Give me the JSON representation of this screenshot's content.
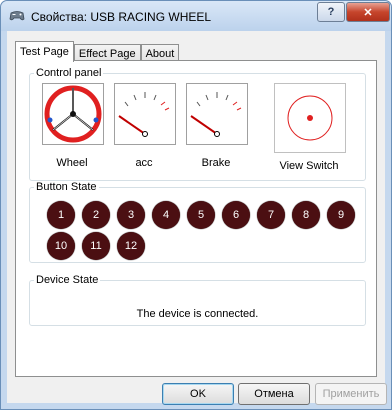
{
  "window": {
    "title": "Свойства: USB RACING WHEEL",
    "help": "?",
    "close": "✕"
  },
  "tabs": [
    {
      "label": "Test Page",
      "active": true
    },
    {
      "label": "Effect Page",
      "active": false
    },
    {
      "label": "About",
      "active": false
    }
  ],
  "control_panel": {
    "legend": "Control panel",
    "wheel_label": "Wheel",
    "acc_label": "acc",
    "brake_label": "Brake",
    "view_switch_label": "View Switch"
  },
  "button_state": {
    "legend": "Button State",
    "buttons": [
      "1",
      "2",
      "3",
      "4",
      "5",
      "6",
      "7",
      "8",
      "9",
      "10",
      "11",
      "12"
    ],
    "color": "#4b0f12"
  },
  "device_state": {
    "legend": "Device State",
    "message": "The device is connected."
  },
  "dialog": {
    "ok": "OK",
    "cancel": "Отмена",
    "apply": "Применить"
  },
  "colors": {
    "wheel_red": "#e02020",
    "needle_red": "#c00000"
  }
}
